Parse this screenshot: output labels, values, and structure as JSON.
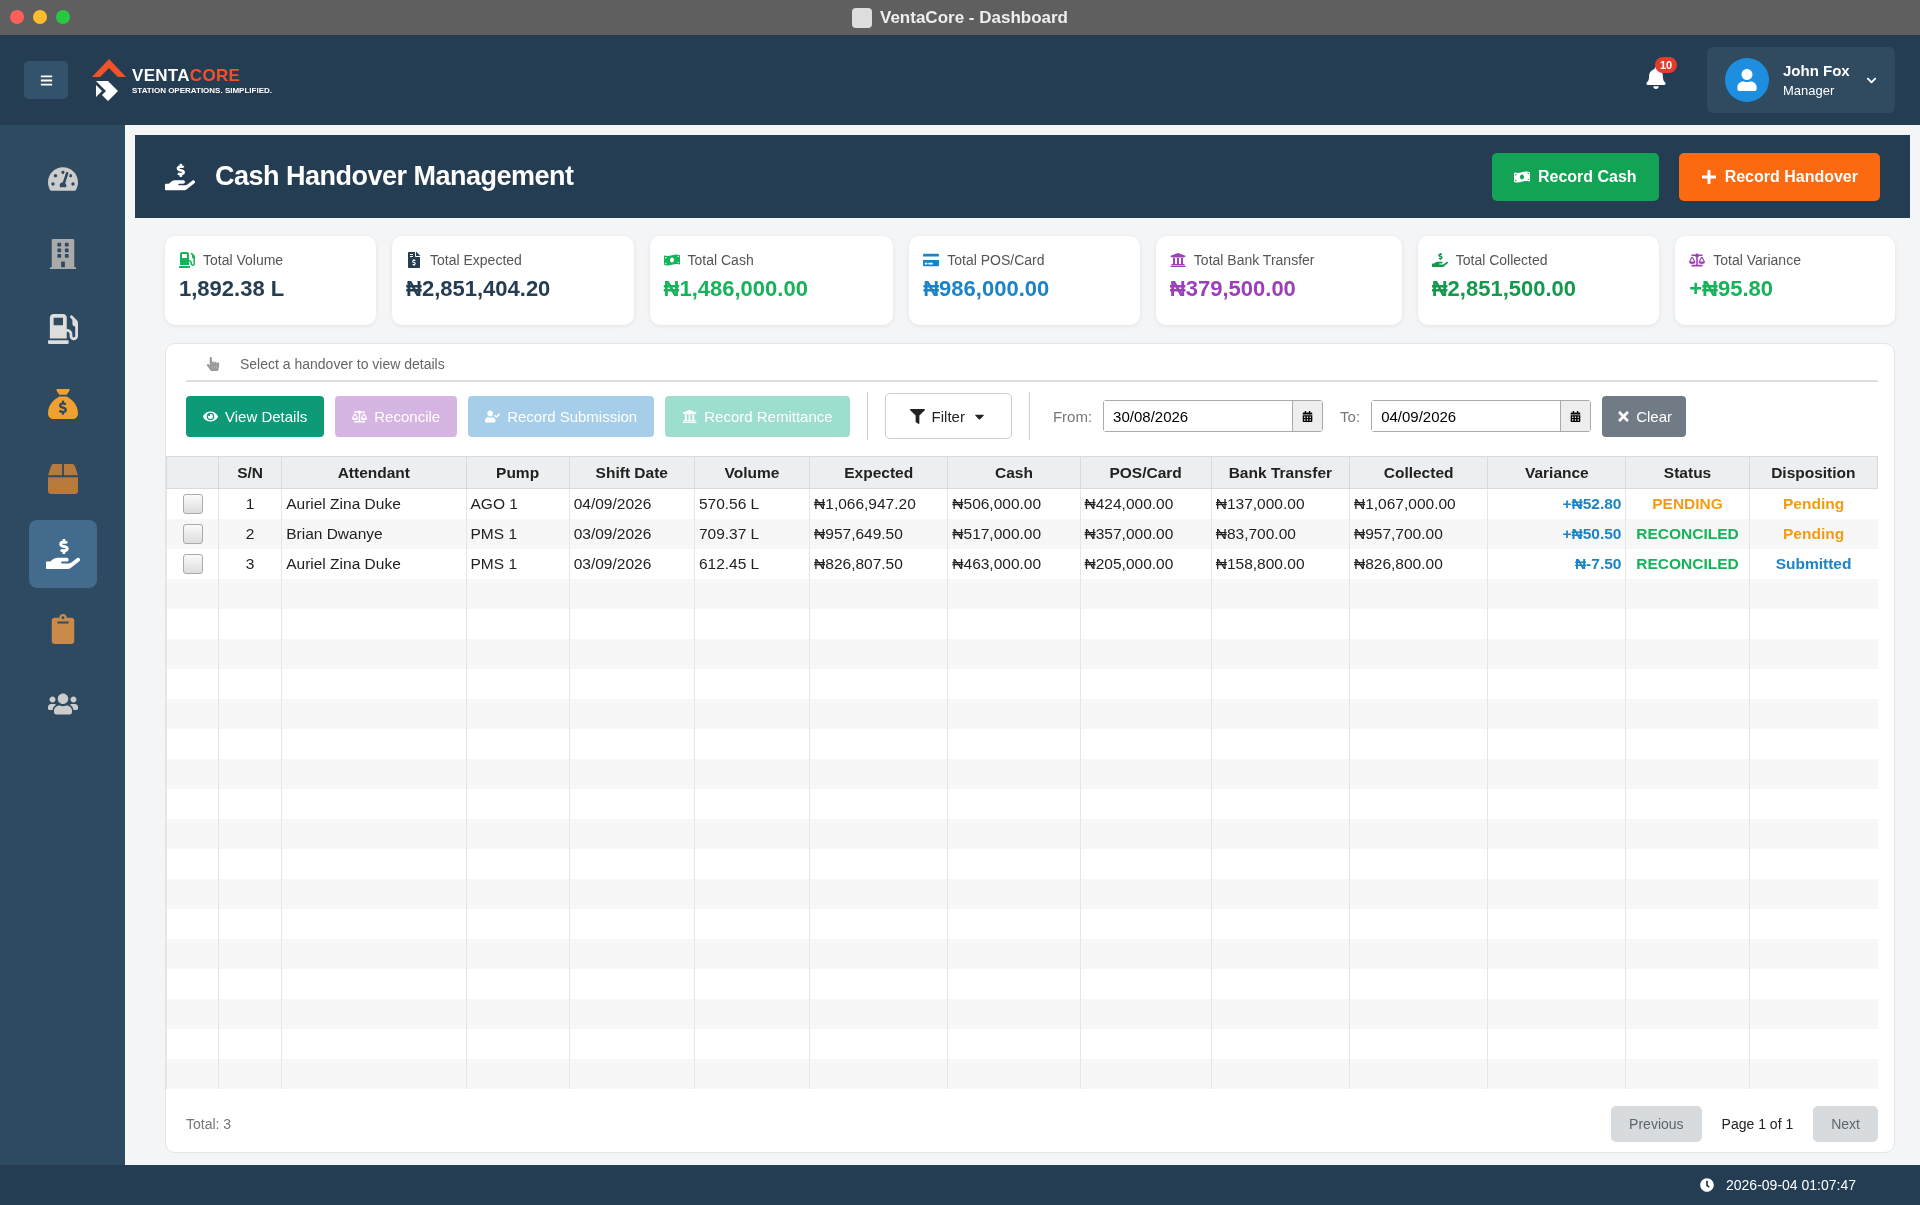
{
  "window": {
    "title": "VentaCore - Dashboard"
  },
  "header": {
    "logo": {
      "part_1": "VENTA",
      "part_2": "CORE",
      "tagline": "STATION OPERATIONS. SIMPLIFIED."
    },
    "notifications": "10",
    "user": {
      "name": "John Fox",
      "role": "Manager"
    }
  },
  "sidebar": {
    "items": [
      {
        "selected": false
      },
      {
        "selected": false
      },
      {
        "selected": false
      },
      {
        "selected": false
      },
      {
        "selected": false
      },
      {
        "selected": true
      },
      {
        "selected": false
      },
      {
        "selected": false
      }
    ]
  },
  "page": {
    "title": "Cash Handover Management",
    "actions": [
      "Record Cash",
      "Record Handover"
    ]
  },
  "stats": [
    {
      "label": "Total Volume",
      "value": "1,892.38 L",
      "color": "#253d52"
    },
    {
      "label": "Total Expected",
      "value": "₦2,851,404.20",
      "color": "#253d52"
    },
    {
      "label": "Total Cash",
      "value": "₦1,486,000.00",
      "color": "#16b35a"
    },
    {
      "label": "Total POS/Card",
      "value": "₦986,000.00",
      "color": "#1b84c6"
    },
    {
      "label": "Total Bank Transfer",
      "value": "₦379,500.00",
      "color": "#9b40b8"
    },
    {
      "label": "Total Collected",
      "value": "₦2,851,500.00",
      "color": "#14994d"
    },
    {
      "label": "Total Variance",
      "value": "+₦95.80",
      "color": "#16b35a"
    }
  ],
  "hint": "Select a handover to view details",
  "toolbar": {
    "buttons": [
      {
        "label": "View Details",
        "disabled": false
      },
      {
        "label": "Reconcile",
        "disabled": true
      },
      {
        "label": "Record Submission",
        "disabled": true
      },
      {
        "label": "Record Remittance",
        "disabled": true
      }
    ],
    "filter": "Filter",
    "from_label": "From:",
    "from": "30/08/2026",
    "to_label": "To:",
    "to": "04/09/2026",
    "clear": "Clear"
  },
  "table": {
    "columns": [
      "S/N",
      "Attendant",
      "Pump",
      "Shift Date",
      "Volume",
      "Expected",
      "Cash",
      "POS/Card",
      "Bank Transfer",
      "Collected",
      "Variance",
      "Status",
      "Disposition"
    ],
    "rows": [
      {
        "checked": false,
        "cells": [
          "1",
          "Auriel Zina Duke",
          "AGO 1",
          "04/09/2026",
          "570.56 L",
          "₦1,066,947.20",
          "₦506,000.00",
          "₦424,000.00",
          "₦137,000.00",
          "₦1,067,000.00"
        ],
        "variance": "+₦52.80",
        "status": {
          "text": "PENDING",
          "color": "#f39c12"
        },
        "disposition": {
          "text": "Pending",
          "color": "#f39c12"
        }
      },
      {
        "checked": false,
        "cells": [
          "2",
          "Brian Dwanye",
          "PMS 1",
          "03/09/2026",
          "709.37 L",
          "₦957,649.50",
          "₦517,000.00",
          "₦357,000.00",
          "₦83,700.00",
          "₦957,700.00"
        ],
        "variance": "+₦50.50",
        "status": {
          "text": "RECONCILED",
          "color": "#16b35a"
        },
        "disposition": {
          "text": "Pending",
          "color": "#f39c12"
        }
      },
      {
        "checked": false,
        "cells": [
          "3",
          "Auriel Zina Duke",
          "PMS 1",
          "03/09/2026",
          "612.45 L",
          "₦826,807.50",
          "₦463,000.00",
          "₦205,000.00",
          "₦158,800.00",
          "₦826,800.00"
        ],
        "variance": "₦-7.50",
        "status": {
          "text": "RECONCILED",
          "color": "#16b35a"
        },
        "disposition": {
          "text": "Submitted",
          "color": "#1b84c6"
        }
      }
    ]
  },
  "footer": {
    "total": "Total: 3",
    "previous": {
      "label": "Previous",
      "disabled": true
    },
    "page": "Page 1 of 1",
    "next": {
      "label": "Next",
      "disabled": true
    }
  },
  "status_bar": {
    "time": "2026-09-04 01:07:47"
  }
}
